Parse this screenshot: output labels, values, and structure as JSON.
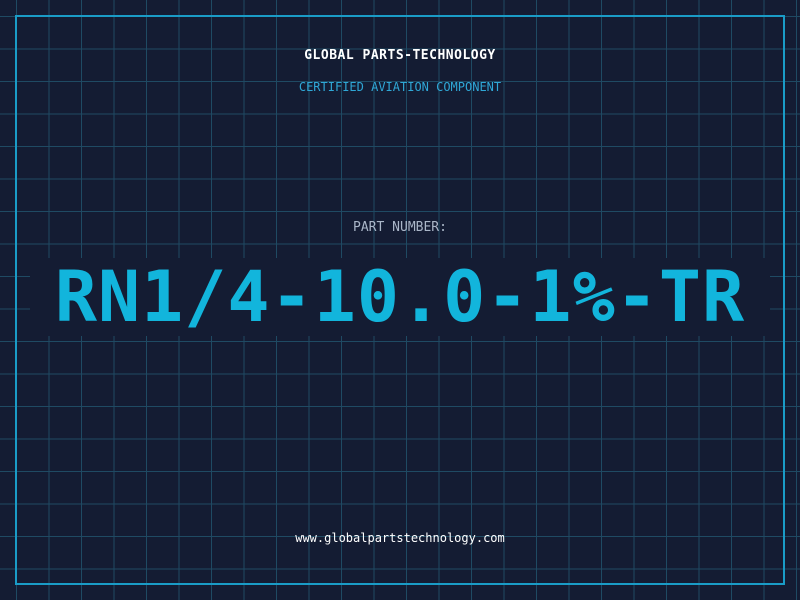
{
  "header": {
    "company": "GLOBAL PARTS-TECHNOLOGY",
    "subtitle": "CERTIFIED AVIATION COMPONENT"
  },
  "part": {
    "label": "PART NUMBER:",
    "number": "RN1/4-10.0-1%-TR"
  },
  "footer": {
    "url": "www.globalpartstechnology.com"
  },
  "colors": {
    "background": "#141c33",
    "grid": "#1f4a63",
    "frame": "#1a9cc7",
    "accent": "#12b5dc",
    "subtitle": "#2fa7d6"
  }
}
